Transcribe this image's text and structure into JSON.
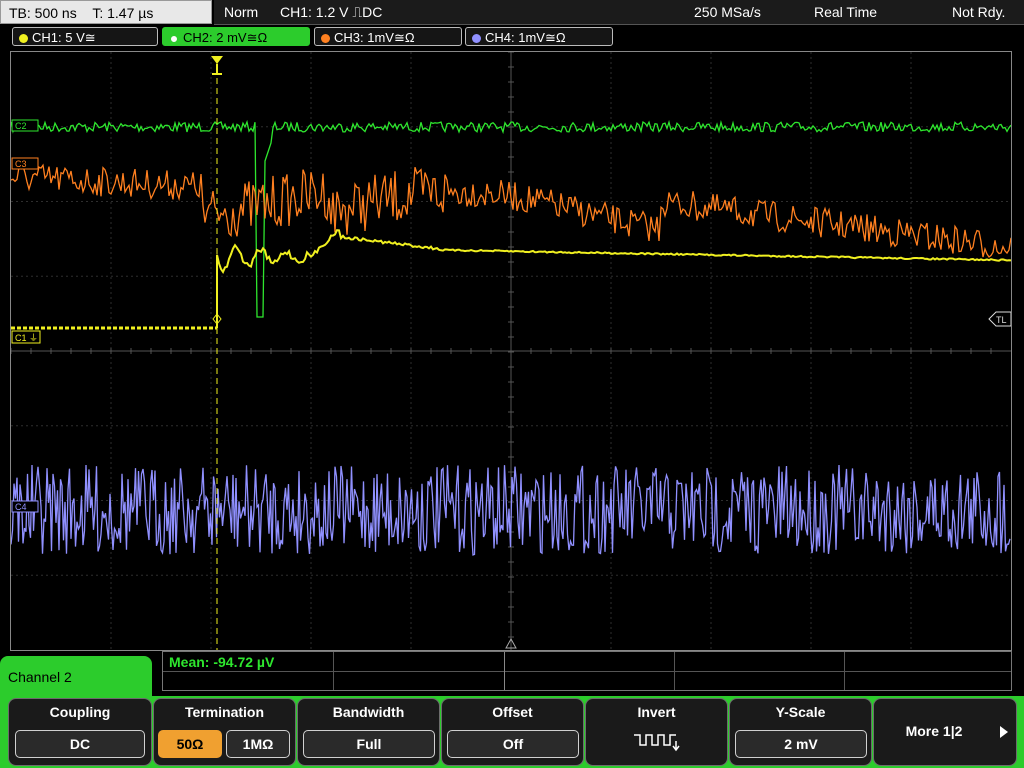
{
  "topbar": {
    "timebase": "TB: 500 ns",
    "trigger_time": "T: 1.47 µs",
    "mode": "Norm",
    "trigger": "CH1: 1.2 V ⎍DC",
    "sample_rate": "250 MSa/s",
    "acq_mode": "Real Time",
    "status": "Not Rdy."
  },
  "channels": [
    {
      "label": "CH1: 5 V≅",
      "color": "#f0f020"
    },
    {
      "label": "CH2: 2 mV≅Ω",
      "color": "#2ee62e"
    },
    {
      "label": "CH3: 1mV≅Ω",
      "color": "#ff8020"
    },
    {
      "label": "CH4: 1mV≅Ω",
      "color": "#9090ff"
    }
  ],
  "scope": {
    "markers": {
      "c1": "C1",
      "c2": "C2",
      "c3": "C3",
      "c4": "C4",
      "tl": "TL",
      "trig": "T"
    }
  },
  "measurement": "Mean: -94.72 µV",
  "panel": {
    "title": "Channel 2"
  },
  "softkeys": {
    "coupling": {
      "title": "Coupling",
      "value": "DC"
    },
    "termination": {
      "title": "Termination",
      "opt1": "50Ω",
      "opt2": "1MΩ"
    },
    "bandwidth": {
      "title": "Bandwidth",
      "value": "Full"
    },
    "offset": {
      "title": "Offset",
      "value": "Off"
    },
    "invert": {
      "title": "Invert"
    },
    "yscale": {
      "title": "Y-Scale",
      "value": "2 mV"
    },
    "more": {
      "label": "More 1|2"
    }
  }
}
